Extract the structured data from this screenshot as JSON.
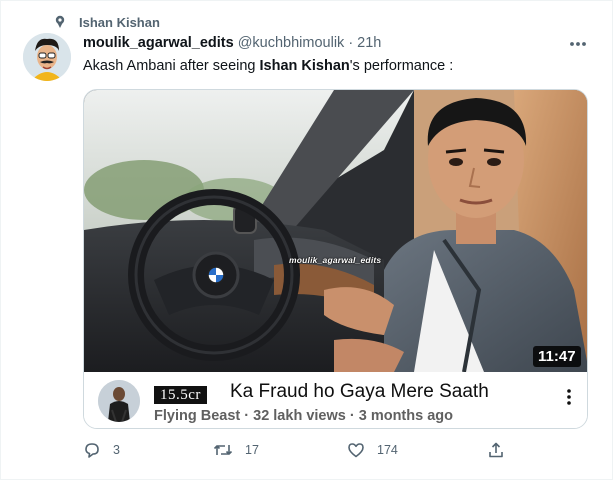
{
  "context": {
    "icon": "pin-icon",
    "label": "Ishan Kishan"
  },
  "tweet": {
    "display_name": "moulik_agarwal_edits",
    "handle": "@kuchbhimoulik",
    "separator": "·",
    "time": "21h",
    "text_prefix": "Akash Ambani after seeing ",
    "text_bold": "Ishan Kishan",
    "text_suffix": "'s performance :"
  },
  "media": {
    "watermark": "moulik_agarwal_edits",
    "duration": "11:47",
    "badge": "15.5cr",
    "video_title": "Ka Fraud ho Gaya Mere Saath",
    "channel": "Flying Beast",
    "views": "32 lakh views",
    "meta_sep": "·",
    "age": "3 months ago"
  },
  "actions": {
    "reply_count": "3",
    "retweet_count": "17",
    "like_count": "174"
  },
  "colors": {
    "secondary_text": "#536471",
    "border": "#cfd9de",
    "primary_text": "#0f1419"
  }
}
